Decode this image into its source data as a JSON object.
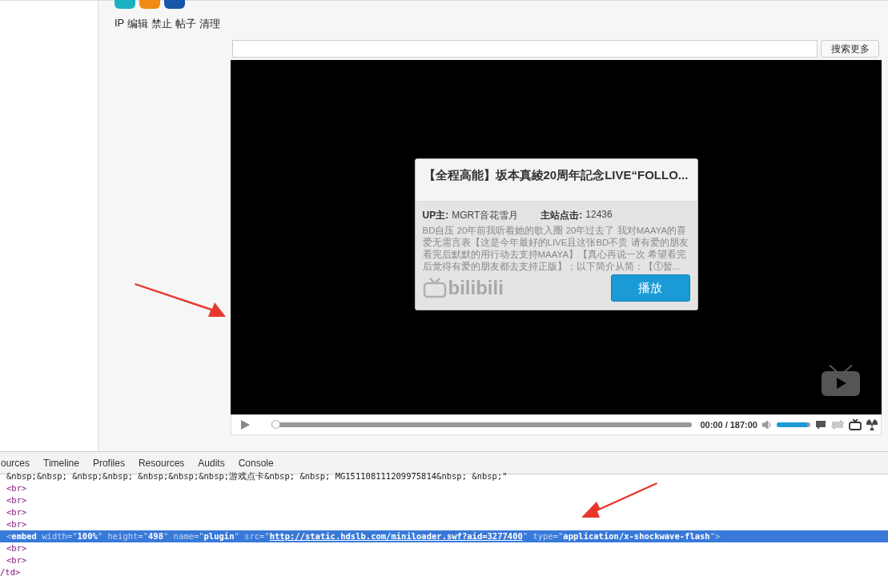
{
  "toolbar": {
    "links": [
      "IP",
      "编辑",
      "禁止",
      "帖子",
      "清理"
    ]
  },
  "search": {
    "button": "搜索更多"
  },
  "player": {
    "popup": {
      "title": "【全程高能】坂本真綾20周年記念LIVE“FOLLO...",
      "up_label": "UP主:",
      "uploader": "MGRT音花雪月",
      "clicks_label": "主站点击:",
      "clicks": "12436",
      "description": "BD自压 20年前我听着她的歌入圈 20年过去了 我对MAAYA的喜爱无需言表【这是今年最好的LIVE且这张BD不贵 请有爱的朋友看完后默默的用行动去支持MAAYA】【真心再说一次 希望看完后觉得有爱的朋友都去支持正版】；以下简介从简：【①暂...",
      "logo": "bilibili",
      "play_button": "播放"
    },
    "controls": {
      "progress": {
        "level": 0
      },
      "time": "00:00 / 187:00",
      "volume": {
        "level": 0.9
      }
    }
  },
  "devtools": {
    "tabs": [
      {
        "label": "ources",
        "selected": false
      },
      {
        "label": "Timeline",
        "selected": false
      },
      {
        "label": "Profiles",
        "selected": false
      },
      {
        "label": "Resources",
        "selected": false
      },
      {
        "label": "Audits",
        "selected": false
      },
      {
        "label": "Console",
        "selected": false
      }
    ],
    "lines": [
      {
        "kind": "text",
        "text": "&nbsp;&nbsp; &nbsp;&nbsp; &nbsp;&nbsp;&nbsp;游戏点卡&nbsp; &nbsp; MG151108111209975814&nbsp; &nbsp;\"",
        "selected": false
      },
      {
        "kind": "tag",
        "tag": "<br>",
        "selected": false
      },
      {
        "kind": "tag",
        "tag": "<br>",
        "selected": false
      },
      {
        "kind": "tag",
        "tag": "<br>",
        "selected": false
      },
      {
        "kind": "tag",
        "tag": "<br>",
        "selected": false
      },
      {
        "kind": "element",
        "open": "<",
        "tag": "embed",
        "attrs": [
          {
            "name": "width=\"",
            "value": "100%",
            "end": "\"",
            "link": false
          },
          {
            "name": "height=\"",
            "value": "498",
            "end": "\"",
            "link": false
          },
          {
            "name": "name=\"",
            "value": "plugin",
            "end": "\"",
            "link": false
          },
          {
            "name": "src=\"",
            "value": "http://static.hdslb.com/miniloader.swf?aid=3277400",
            "end": "\"",
            "link": true
          },
          {
            "name": "type=\"",
            "value": "application/x-shockwave-flash",
            "end": "\"",
            "link": false
          }
        ],
        "close": ">",
        "selected": true
      },
      {
        "kind": "tag",
        "tag": "<br>",
        "selected": false
      },
      {
        "kind": "tag",
        "tag": "<br>",
        "selected": false
      },
      {
        "kind": "close",
        "tag": "/td>",
        "selected": false
      }
    ]
  }
}
